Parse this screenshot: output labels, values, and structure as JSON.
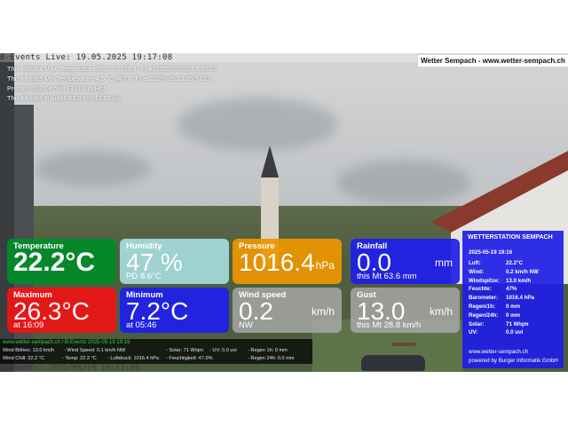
{
  "webcam": {
    "timestamp_top": "B-Events Live: 19.05.2025 19:17:08",
    "timestamp_bottom": "B-Events: 2025/05/19 19:17:08",
    "site_banner": "Wetter Sempach - www.wetter-sempach.ch"
  },
  "stats": {
    "line1": "This Months Max Temperature 28.5 °C (83.3 °F) at 2025-05-02 17:33:12",
    "line2": "This Months Min Temperature 4.5 °C (40.1 °F) at 2025-05-10 05:57:10",
    "line3": "Presure 1016.4 hPa (30.00 in/Hg)",
    "line4": "This Months Rainfall 63.6 mm (2.51 in)"
  },
  "tiles": {
    "temperature": {
      "label": "Temperature",
      "value": "22.2°C",
      "color": "#008c28"
    },
    "humidity": {
      "label": "Humidity",
      "value": "47 %",
      "sub": "PD 8.6°C",
      "color": "#aae1e4"
    },
    "pressure": {
      "label": "Pressure",
      "value": "1016.4",
      "unit": "hPa",
      "color": "#eb9600"
    },
    "rainfall": {
      "label": "Rainfall",
      "value": "0.0",
      "unit": "mm",
      "sub": "this Mt 63.6 mm",
      "color": "#1e1eeb"
    },
    "maximum": {
      "label": "Maximum",
      "value": "26.3°C",
      "sub": "at 16:09",
      "color": "#f01414"
    },
    "minimum": {
      "label": "Minimum",
      "value": "7.2°C",
      "sub": "at 05:46",
      "color": "#1e1eeb"
    },
    "wind_speed": {
      "label": "Wind speed",
      "value": "0.2",
      "unit": "km/h",
      "sub": "NW",
      "color": "#aaaaaa"
    },
    "gust": {
      "label": "Gust",
      "value": "13.0",
      "unit": "km/h",
      "sub": "this Mt 28.8 km/h",
      "color": "#aaaaaa"
    }
  },
  "station": {
    "title": "WETTERSTATION SEMPACH",
    "stamp": "2025-05-19 19:16",
    "rows": [
      {
        "k": "Luft:",
        "v": "22.2°C"
      },
      {
        "k": "Wind:",
        "v": "0.2 km/h   NW"
      },
      {
        "k": "Windspitze:",
        "v": "13.0 km/h"
      },
      {
        "k": "Feuchte:",
        "v": "47%"
      },
      {
        "k": "Barometer:",
        "v": "1016.4 hPa"
      },
      {
        "k": "Regen/1h:",
        "v": "0 mm"
      },
      {
        "k": "Regen/24h:",
        "v": "0 mm"
      },
      {
        "k": "Solar:",
        "v": "71 W/qm"
      },
      {
        "k": "UV:",
        "v": "0.0 uvi"
      }
    ],
    "footer1": "www.wetter-sempach.ch",
    "footer2": "powered by Burger Informatik GmbH"
  },
  "bottom_bar": {
    "line1": "www.wetter-sempach.ch / B-Events   2025-05-19 19:16",
    "wind_gusts": "Wind Böhen: 13.0 km/h",
    "wind_speed": "- Wind Speed: 0.1 km/h NW",
    "solar": "- Solar: 71 W/qm",
    "uv": "- UV: 0.0 uvi",
    "rain1h": "- Regen 1h:   0 mm",
    "wind_chill": "Wind Chill: 22.2 °C",
    "temp": "- Temp: 22.2 °C",
    "pressure": "- Luftdruck: 1016.4 hPa",
    "humidity": "- Feuchtigkeit: 47.0%",
    "rain24h": "- Regen 24h: 0.0 mm"
  }
}
